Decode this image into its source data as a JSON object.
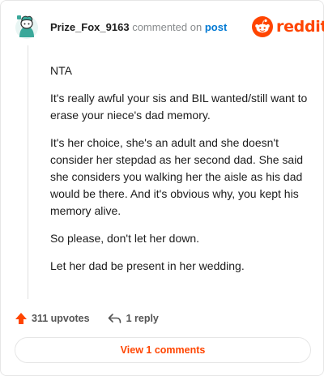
{
  "header": {
    "username": "Prize_Fox_9163",
    "commented_on": "commented on",
    "post_link": "post",
    "logo_word": "reddit"
  },
  "comment": {
    "paragraphs": [
      "NTA",
      "It's really awful your sis and BIL wanted/still want to erase your niece's dad memory.",
      "It's her choice, she's an adult and she doesn't consider her stepdad as her second dad. She said she considers you walking her the aisle as his dad would be there. And it's obvious why, you kept his memory alive.",
      "So please, don't let her down.",
      "Let her dad be present in her wedding."
    ]
  },
  "footer": {
    "upvotes": "311 upvotes",
    "replies": "1 reply",
    "view_button": "View 1 comments"
  },
  "icons": {
    "avatar": "snoo-avatar-icon",
    "logo": "reddit-logo-icon",
    "upvote": "upvote-arrow-icon",
    "reply": "reply-arrow-icon"
  },
  "colors": {
    "brand": "#ff4500",
    "link": "#0079d3",
    "muted": "#878a8c",
    "avatar_teal": "#3aa89a"
  }
}
